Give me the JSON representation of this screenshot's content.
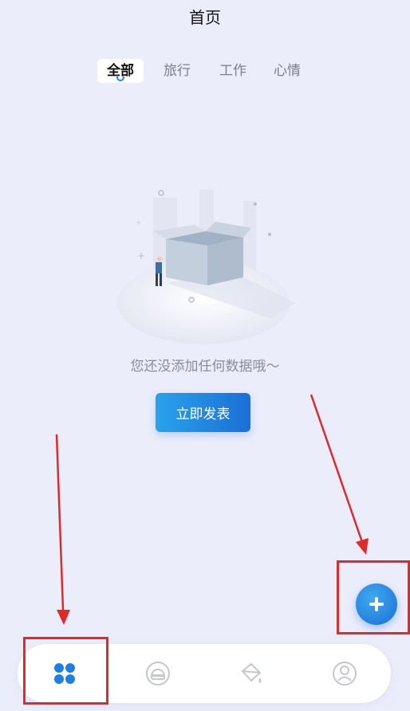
{
  "header": {
    "title": "首页"
  },
  "tabs": [
    {
      "label": "全部",
      "active": true
    },
    {
      "label": "旅行",
      "active": false
    },
    {
      "label": "工作",
      "active": false
    },
    {
      "label": "心情",
      "active": false
    }
  ],
  "empty_state": {
    "message": "您还没添加任何数据哦～",
    "illustration": "open-box-icon",
    "action_label": "立即发表"
  },
  "fab": {
    "icon": "plus-icon"
  },
  "bottom_nav": [
    {
      "icon": "grid-dots-icon",
      "active": true
    },
    {
      "icon": "car-icon",
      "active": false
    },
    {
      "icon": "paint-bucket-icon",
      "active": false
    },
    {
      "icon": "user-profile-icon",
      "active": false
    }
  ],
  "colors": {
    "background": "#ecedfb",
    "accent": "#1b6fd6",
    "annotation": "#e02a2a",
    "inactive_icon": "#c5c7cf"
  }
}
